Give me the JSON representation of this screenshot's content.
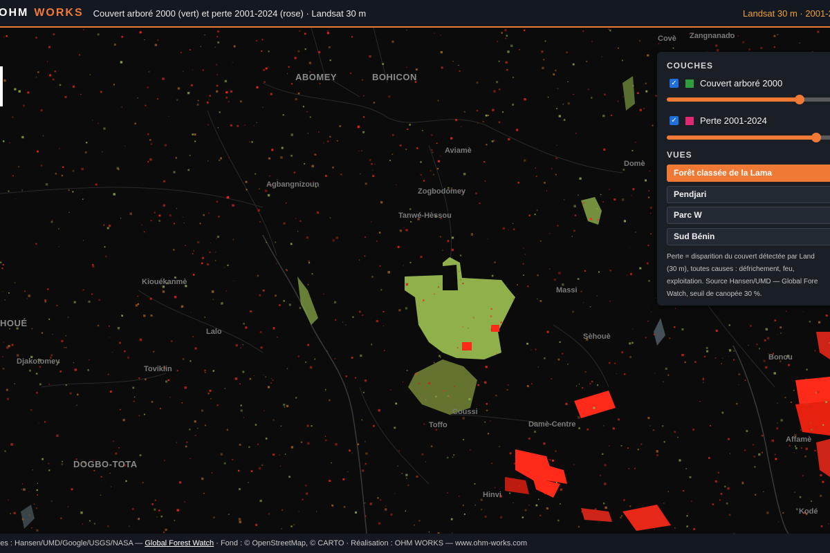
{
  "header": {
    "brand_part1": "OHM",
    "brand_part2": "WORKS",
    "subtitle": "Couvert arboré 2000 (vert) et perte 2001-2024 (rose) · Landsat 30 m",
    "right_text": "Landsat 30 m · 2001-2"
  },
  "map": {
    "places": [
      {
        "name": "ABOMEY",
        "size": "big"
      },
      {
        "name": "BOHICON",
        "size": "big"
      },
      {
        "name": "Covè"
      },
      {
        "name": "Zangnanado"
      },
      {
        "name": "Aviamè"
      },
      {
        "name": "Domè"
      },
      {
        "name": "Agbangnizoun"
      },
      {
        "name": "Zogbodomey"
      },
      {
        "name": "Tanwé-Hèssou"
      },
      {
        "name": "Kiouékanmè"
      },
      {
        "name": "Massi"
      },
      {
        "name": "HOUÉ",
        "size": "big"
      },
      {
        "name": "Lalo"
      },
      {
        "name": "Sèhouè"
      },
      {
        "name": "Djakotomey"
      },
      {
        "name": "Toviklin"
      },
      {
        "name": "Bonou"
      },
      {
        "name": "Coussi"
      },
      {
        "name": "Toffo"
      },
      {
        "name": "Damè-Centre"
      },
      {
        "name": "Affamè"
      },
      {
        "name": "DOGBO-TOTA",
        "size": "big"
      },
      {
        "name": "Hinvi"
      },
      {
        "name": "Kodé"
      }
    ]
  },
  "panel": {
    "layers_heading": "COUCHES",
    "layers": [
      {
        "label": "Couvert arboré 2000",
        "checked": true,
        "color": "#2e9e3e",
        "opacity": 0.8
      },
      {
        "label": "Perte 2001-2024",
        "checked": true,
        "color": "#e0286e",
        "opacity": 0.9
      }
    ],
    "views_heading": "VUES",
    "views": [
      {
        "label": "Forêt classée de la Lama",
        "active": true
      },
      {
        "label": "Pendjari",
        "active": false
      },
      {
        "label": "Parc W",
        "active": false
      },
      {
        "label": "Sud Bénin",
        "active": false
      }
    ],
    "note_lines": [
      "Perte = disparition du couvert détectée par Land",
      "(30 m), toutes causes : défrichement, feu,",
      "exploitation. Source Hansen/UMD — Global Fore",
      "Watch, seuil de canopée 30 %."
    ]
  },
  "footer": {
    "text_before": "nées : Hansen/UMD/Google/USGS/NASA — ",
    "link_text": "Global Forest Watch",
    "text_after": " · Fond : © OpenStreetMap, © CARTO · Réalisation : OHM WORKS — www.ohm-works.com"
  },
  "colors": {
    "accent": "#f07a35",
    "tree_cover": "#8fb04a",
    "loss": "#ff2a1a",
    "background": "#0b0b0b"
  }
}
